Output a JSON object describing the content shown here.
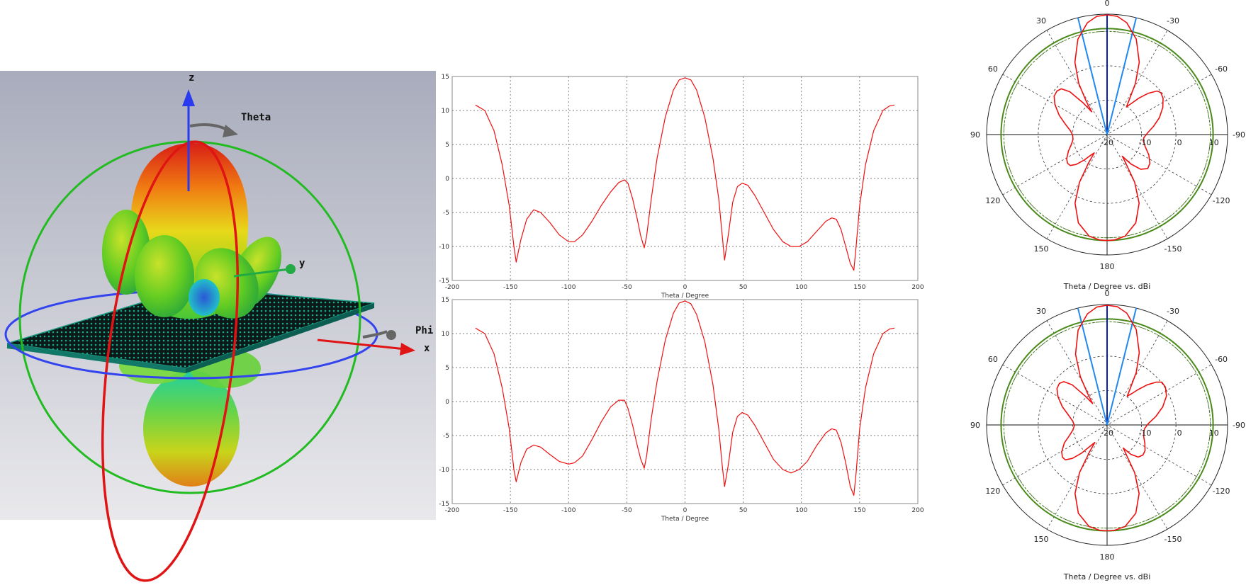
{
  "view3d": {
    "axis_labels": {
      "z": "z",
      "y": "y",
      "x": "x",
      "theta": "Theta",
      "phi": "Phi"
    }
  },
  "chart_data": [
    {
      "type": "line",
      "xlabel": "Theta / Degree",
      "ylabel": "",
      "xlim": [
        -200,
        200
      ],
      "ylim": [
        -15,
        15
      ],
      "xticks": [
        -200,
        -150,
        -100,
        -50,
        0,
        50,
        100,
        150,
        200
      ],
      "yticks": [
        -15,
        -10,
        -5,
        0,
        5,
        10,
        15
      ],
      "grid": true,
      "series": [
        {
          "color": "#ee1111",
          "x": [
            -180,
            -172,
            -164,
            -157,
            -151,
            -147,
            -145,
            -141,
            -136,
            -130,
            -124,
            -116,
            -108,
            -100,
            -95,
            -88,
            -80,
            -72,
            -64,
            -57,
            -52,
            -49,
            -45,
            -41,
            -38,
            -35,
            -33,
            -29,
            -24,
            -17,
            -10,
            -5,
            0,
            5,
            10,
            17,
            24,
            29,
            32,
            34,
            37,
            41,
            45,
            49,
            54,
            60,
            68,
            76,
            84,
            91,
            98,
            105,
            113,
            121,
            126,
            130,
            134,
            138,
            142,
            145,
            147,
            150,
            155,
            162,
            170,
            176,
            180
          ],
          "y": [
            10.8,
            10,
            7,
            2,
            -4,
            -10,
            -12.3,
            -9,
            -6,
            -4.6,
            -5,
            -6.5,
            -8.3,
            -9.3,
            -9.3,
            -8.3,
            -6.3,
            -4,
            -2,
            -0.6,
            -0.2,
            -0.7,
            -3,
            -6,
            -8.5,
            -10.2,
            -8.5,
            -3,
            3,
            9,
            13,
            14.5,
            14.8,
            14.5,
            13,
            9,
            3,
            -3,
            -8.5,
            -12,
            -8.5,
            -3.5,
            -1.2,
            -0.7,
            -1,
            -2.5,
            -5,
            -7.5,
            -9.3,
            -10,
            -10,
            -9.3,
            -7.8,
            -6.3,
            -5.8,
            -6,
            -7.5,
            -10,
            -12.5,
            -13.5,
            -10,
            -4,
            2,
            7,
            10,
            10.7,
            10.8
          ]
        }
      ]
    },
    {
      "type": "line",
      "xlabel": "Theta / Degree",
      "ylabel": "",
      "xlim": [
        -200,
        200
      ],
      "ylim": [
        -15,
        15
      ],
      "xticks": [
        -200,
        -150,
        -100,
        -50,
        0,
        50,
        100,
        150,
        200
      ],
      "yticks": [
        -15,
        -10,
        -5,
        0,
        5,
        10,
        15
      ],
      "grid": true,
      "series": [
        {
          "color": "#ee1111",
          "x": [
            -180,
            -172,
            -164,
            -157,
            -151,
            -147,
            -145,
            -141,
            -136,
            -130,
            -124,
            -116,
            -108,
            -100,
            -95,
            -88,
            -80,
            -72,
            -64,
            -57,
            -52,
            -49,
            -45,
            -41,
            -38,
            -35,
            -33,
            -29,
            -24,
            -17,
            -10,
            -5,
            0,
            5,
            10,
            17,
            24,
            29,
            32,
            34,
            37,
            41,
            45,
            49,
            54,
            60,
            68,
            76,
            84,
            91,
            98,
            105,
            113,
            121,
            126,
            130,
            134,
            138,
            142,
            145,
            147,
            150,
            155,
            162,
            170,
            176,
            180
          ],
          "y": [
            10.8,
            10,
            7,
            2,
            -4,
            -10,
            -11.8,
            -9,
            -7,
            -6.4,
            -6.7,
            -7.8,
            -8.8,
            -9.2,
            -9,
            -8,
            -5.6,
            -3,
            -0.8,
            0.2,
            0.2,
            -1,
            -3.5,
            -6.5,
            -8.5,
            -9.8,
            -8,
            -2.5,
            3,
            9,
            13,
            14.5,
            14.8,
            14.4,
            12.8,
            8.8,
            2.5,
            -4,
            -9.5,
            -12.5,
            -9.5,
            -4.5,
            -2.2,
            -1.6,
            -2,
            -3.5,
            -6,
            -8.5,
            -10,
            -10.5,
            -10,
            -8.8,
            -6.5,
            -4.6,
            -4,
            -4.2,
            -6,
            -9,
            -12.5,
            -13.8,
            -10.5,
            -4,
            2,
            7,
            10,
            10.7,
            10.8
          ]
        }
      ]
    },
    {
      "type": "polar",
      "title": "Theta / Degree vs. dBi",
      "angle_labels": [
        "0",
        "30",
        "60",
        "90",
        "120",
        "150",
        "180",
        "-150",
        "-120",
        "-90",
        "-60",
        "-30"
      ],
      "radial_labels": [
        "-20",
        "-10",
        "0",
        "10"
      ],
      "rlim": [
        -20,
        15
      ],
      "grid": true,
      "series": [
        {
          "name": "",
          "color": "#ee1111",
          "theta": [
            0,
            5,
            10,
            17,
            24,
            29,
            32,
            34,
            37,
            41,
            45,
            49,
            54,
            60,
            68,
            76,
            84,
            91,
            98,
            105,
            113,
            121,
            126,
            130,
            134,
            138,
            142,
            145,
            147,
            150,
            155,
            162,
            170,
            176,
            180,
            184,
            190,
            198,
            205,
            210,
            213,
            215,
            219,
            224,
            230,
            236,
            244,
            252,
            260,
            265,
            272,
            280,
            288,
            296,
            303,
            308,
            311,
            315,
            319,
            322,
            325,
            327,
            331,
            336,
            343,
            350,
            355,
            360
          ],
          "r": [
            14.8,
            14.5,
            13,
            9,
            3,
            -3,
            -8.5,
            -12,
            -8.5,
            -3.5,
            -1.2,
            -0.7,
            -1,
            -2.5,
            -5,
            -7.5,
            -9.3,
            -10,
            -10,
            -9.3,
            -7.8,
            -6.3,
            -5.8,
            -6,
            -7.5,
            -10,
            -12.5,
            -13.5,
            -10,
            -4,
            2,
            7,
            10,
            10.7,
            10.8,
            10.7,
            10,
            7,
            2,
            -4,
            -10,
            -12.3,
            -9,
            -6,
            -4.6,
            -5,
            -6.5,
            -8.3,
            -9.3,
            -9.3,
            -8.3,
            -6.3,
            -4,
            -2,
            -0.6,
            -0.2,
            -0.7,
            -3,
            -6,
            -8.5,
            -10.2,
            -8.5,
            -3,
            3,
            9,
            13,
            14.5,
            14.8
          ]
        }
      ],
      "marker_lines": [
        {
          "theta": 0,
          "color": "#0a22aa"
        },
        {
          "theta": 14,
          "color": "#2288ee"
        },
        {
          "theta": -14,
          "color": "#2288ee"
        }
      ],
      "reference_circles": [
        {
          "r": 10.8,
          "color": "#4a8a1a",
          "dashed": false
        },
        {
          "r": 10,
          "color": "#4a8a1a",
          "dashed": true
        }
      ]
    },
    {
      "type": "polar",
      "title": "Theta / Degree vs. dBi",
      "angle_labels": [
        "0",
        "30",
        "60",
        "90",
        "120",
        "150",
        "180",
        "-150",
        "-120",
        "-90",
        "-60",
        "-30"
      ],
      "radial_labels": [
        "-20",
        "-10",
        "0",
        "10"
      ],
      "rlim": [
        -20,
        15
      ],
      "grid": true,
      "series": [
        {
          "name": "",
          "color": "#ee1111",
          "theta": [
            0,
            5,
            10,
            17,
            24,
            29,
            32,
            34,
            37,
            41,
            45,
            49,
            54,
            60,
            68,
            76,
            84,
            91,
            98,
            105,
            113,
            121,
            126,
            130,
            134,
            138,
            142,
            145,
            147,
            150,
            155,
            162,
            170,
            176,
            180,
            184,
            190,
            198,
            205,
            210,
            213,
            215,
            219,
            224,
            230,
            236,
            244,
            252,
            260,
            265,
            272,
            280,
            288,
            296,
            303,
            308,
            311,
            315,
            319,
            322,
            325,
            327,
            331,
            336,
            343,
            350,
            355,
            360
          ],
          "r": [
            14.8,
            14.4,
            12.8,
            8.8,
            2.5,
            -4,
            -9.5,
            -12.5,
            -9.5,
            -4.5,
            -2.2,
            -1.6,
            -2,
            -3.5,
            -6,
            -8.5,
            -10,
            -10.5,
            -10,
            -8.8,
            -6.5,
            -4.6,
            -4,
            -4.2,
            -6,
            -9,
            -12.5,
            -13.8,
            -10.5,
            -4,
            2,
            7,
            10,
            10.7,
            10.8,
            10.7,
            10,
            7,
            2,
            -4,
            -10,
            -11.8,
            -9,
            -7,
            -6.4,
            -6.7,
            -7.8,
            -8.8,
            -9.2,
            -9,
            -8,
            -5.6,
            -3,
            -0.8,
            0.2,
            0.2,
            -1,
            -3.5,
            -6.5,
            -8.5,
            -9.8,
            -8,
            -2.5,
            3,
            9,
            13,
            14.5,
            14.8
          ]
        }
      ],
      "marker_lines": [
        {
          "theta": 0,
          "color": "#0a22aa"
        },
        {
          "theta": 14,
          "color": "#2288ee"
        },
        {
          "theta": -14,
          "color": "#2288ee"
        }
      ],
      "reference_circles": [
        {
          "r": 10.8,
          "color": "#4a8a1a",
          "dashed": false
        },
        {
          "r": 10,
          "color": "#4a8a1a",
          "dashed": true
        }
      ]
    }
  ]
}
